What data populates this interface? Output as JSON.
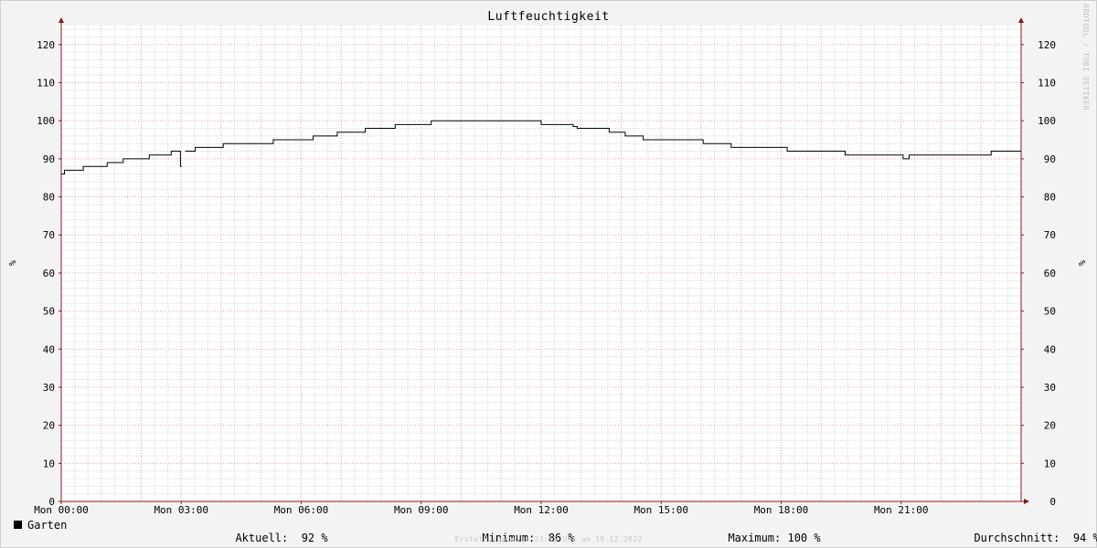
{
  "chart_data": {
    "type": "line",
    "title": "Luftfeuchtigkeit",
    "ylabel": "%",
    "ylim": [
      0,
      125
    ],
    "y_ticks": [
      0,
      10,
      20,
      30,
      40,
      50,
      60,
      70,
      80,
      90,
      100,
      110,
      120
    ],
    "x_range_hours": [
      0,
      24
    ],
    "x_ticks": [
      {
        "hour": 0,
        "label": "Mon 00:00"
      },
      {
        "hour": 3,
        "label": "Mon 03:00"
      },
      {
        "hour": 6,
        "label": "Mon 06:00"
      },
      {
        "hour": 9,
        "label": "Mon 09:00"
      },
      {
        "hour": 12,
        "label": "Mon 12:00"
      },
      {
        "hour": 15,
        "label": "Mon 15:00"
      },
      {
        "hour": 18,
        "label": "Mon 18:00"
      },
      {
        "hour": 21,
        "label": "Mon 21:00"
      }
    ],
    "grid": true,
    "series": [
      {
        "name": "Garten",
        "color": "#000000",
        "segments": [
          [
            [
              0.0,
              86
            ],
            [
              0.08,
              87
            ],
            [
              0.55,
              88
            ],
            [
              1.15,
              89
            ],
            [
              1.55,
              90
            ],
            [
              2.2,
              91
            ],
            [
              2.75,
              92
            ],
            [
              2.98,
              88
            ],
            [
              3.01,
              88
            ]
          ],
          [
            [
              3.1,
              92
            ],
            [
              3.35,
              93
            ],
            [
              4.05,
              94
            ],
            [
              5.3,
              95
            ],
            [
              6.3,
              96
            ],
            [
              6.9,
              97
            ],
            [
              7.6,
              98
            ],
            [
              8.35,
              99
            ],
            [
              9.25,
              100
            ],
            [
              12.0,
              99
            ],
            [
              12.8,
              98.5
            ],
            [
              12.9,
              98
            ],
            [
              13.7,
              97
            ],
            [
              14.1,
              96
            ],
            [
              14.55,
              95
            ],
            [
              16.05,
              94
            ],
            [
              16.75,
              93
            ],
            [
              18.15,
              92
            ],
            [
              19.6,
              91
            ],
            [
              21.0,
              91
            ],
            [
              21.05,
              90
            ],
            [
              21.2,
              91
            ],
            [
              23.2,
              91
            ],
            [
              23.25,
              92
            ],
            [
              24.0,
              92
            ]
          ]
        ]
      }
    ],
    "legend": {
      "series_name": "Garten",
      "aktuell_label": "Aktuell:",
      "aktuell_value": "92 %",
      "minimum_label": "Minimum:",
      "minimum_value": "86 %",
      "maximum_label": "Maximum:",
      "maximum_value": "100 %",
      "durchschnitt_label": "Durchschnitt:",
      "durchschnitt_value": "94 %"
    },
    "watermark": "RRDTOOL / TOBI OETIKER",
    "footer": "Erstellungszeit: 23:55 Uhr am 19.12.2022",
    "colors": {
      "background": "#f3f3f3",
      "canvas": "#ffffff",
      "minor_grid": "#d9d9d9",
      "major_grid": "#e8a0a0",
      "axis": "#8b1a1a",
      "line": "#000000"
    }
  }
}
